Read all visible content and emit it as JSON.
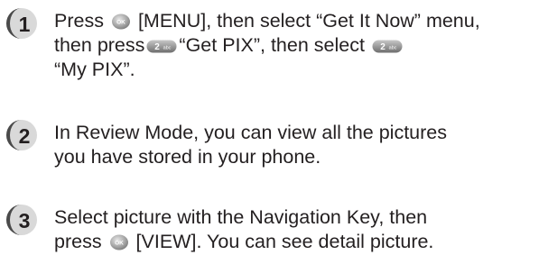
{
  "steps": [
    {
      "number": "1",
      "line1_pre": "Press",
      "line1_key": "[MENU], then select “Get It Now” menu,",
      "line2_pre": "then press",
      "line2_mid": "“Get PIX”, then select",
      "line3": "“My PIX”.",
      "icons": [
        "ok-key-icon",
        "2-abc-key-icon",
        "2-abc-key-icon"
      ]
    },
    {
      "number": "2",
      "line1": "In Review Mode, you can view all the pictures",
      "line2": "you have stored in your phone."
    },
    {
      "number": "3",
      "line1": "Select picture with the Navigation Key, then",
      "line2_pre": "press",
      "line2_post": "[VIEW]. You can see detail picture.",
      "icons": [
        "ok-key-icon"
      ]
    }
  ],
  "key_labels": {
    "ok": "OK",
    "two": "2",
    "abc": "abc"
  },
  "colors": {
    "text": "#231f20",
    "badge_dark": "#4a4a4a",
    "badge_light": "#d9d9d9",
    "key_gray": "#9a9a9a"
  }
}
